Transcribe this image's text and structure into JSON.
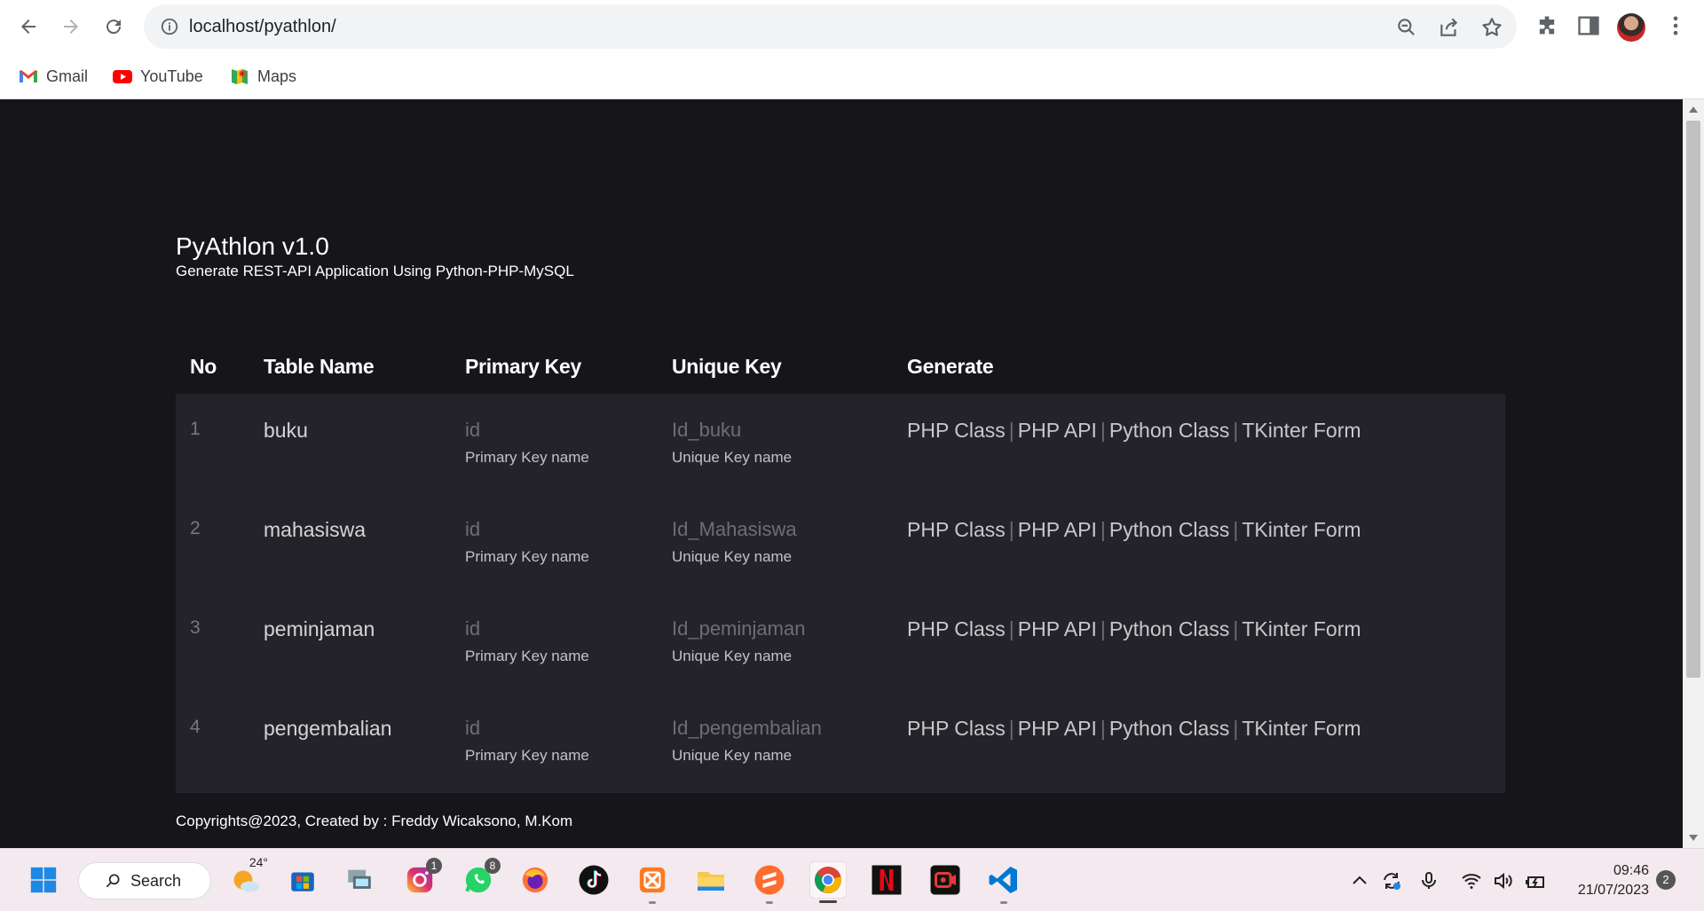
{
  "browser": {
    "url": "localhost/pyathlon/",
    "bookmarks": [
      {
        "label": "Gmail",
        "icon": "gmail-icon"
      },
      {
        "label": "YouTube",
        "icon": "youtube-icon"
      },
      {
        "label": "Maps",
        "icon": "maps-icon"
      }
    ]
  },
  "app": {
    "title": "PyAthlon v1.0",
    "subtitle": "Generate REST-API Application Using Python-PHP-MySQL"
  },
  "table": {
    "headers": {
      "no": "No",
      "table_name": "Table Name",
      "primary_key": "Primary Key",
      "unique_key": "Unique Key",
      "generate": "Generate"
    },
    "rows": [
      {
        "no": "1",
        "name": "buku",
        "pk": "id",
        "pk_hint": "Primary Key name",
        "uk": "Id_buku",
        "uk_hint": "Unique Key name"
      },
      {
        "no": "2",
        "name": "mahasiswa",
        "pk": "id",
        "pk_hint": "Primary Key name",
        "uk": "Id_Mahasiswa",
        "uk_hint": "Unique Key name"
      },
      {
        "no": "3",
        "name": "peminjaman",
        "pk": "id",
        "pk_hint": "Primary Key name",
        "uk": "Id_peminjaman",
        "uk_hint": "Unique Key name"
      },
      {
        "no": "4",
        "name": "pengembalian",
        "pk": "id",
        "pk_hint": "Primary Key name",
        "uk": "Id_pengembalian",
        "uk_hint": "Unique Key name"
      }
    ],
    "generate_links": {
      "php_class": "PHP Class",
      "php_api": "PHP API",
      "python_class": "Python Class",
      "tkinter_form": "TKinter Form",
      "separator": "|"
    }
  },
  "footer": {
    "text": "Copyrights@2023, Created by : Freddy Wicaksono, M.Kom"
  },
  "taskbar": {
    "search_label": "Search",
    "weather_temp": "24°",
    "instagram_badge": "1",
    "whatsapp_badge": "8",
    "time": "09:46",
    "date": "21/07/2023",
    "notification_count": "2"
  },
  "colors": {
    "page_background": "#16161a",
    "table_body": "#232329",
    "taskbar": "#f3e9ee"
  }
}
